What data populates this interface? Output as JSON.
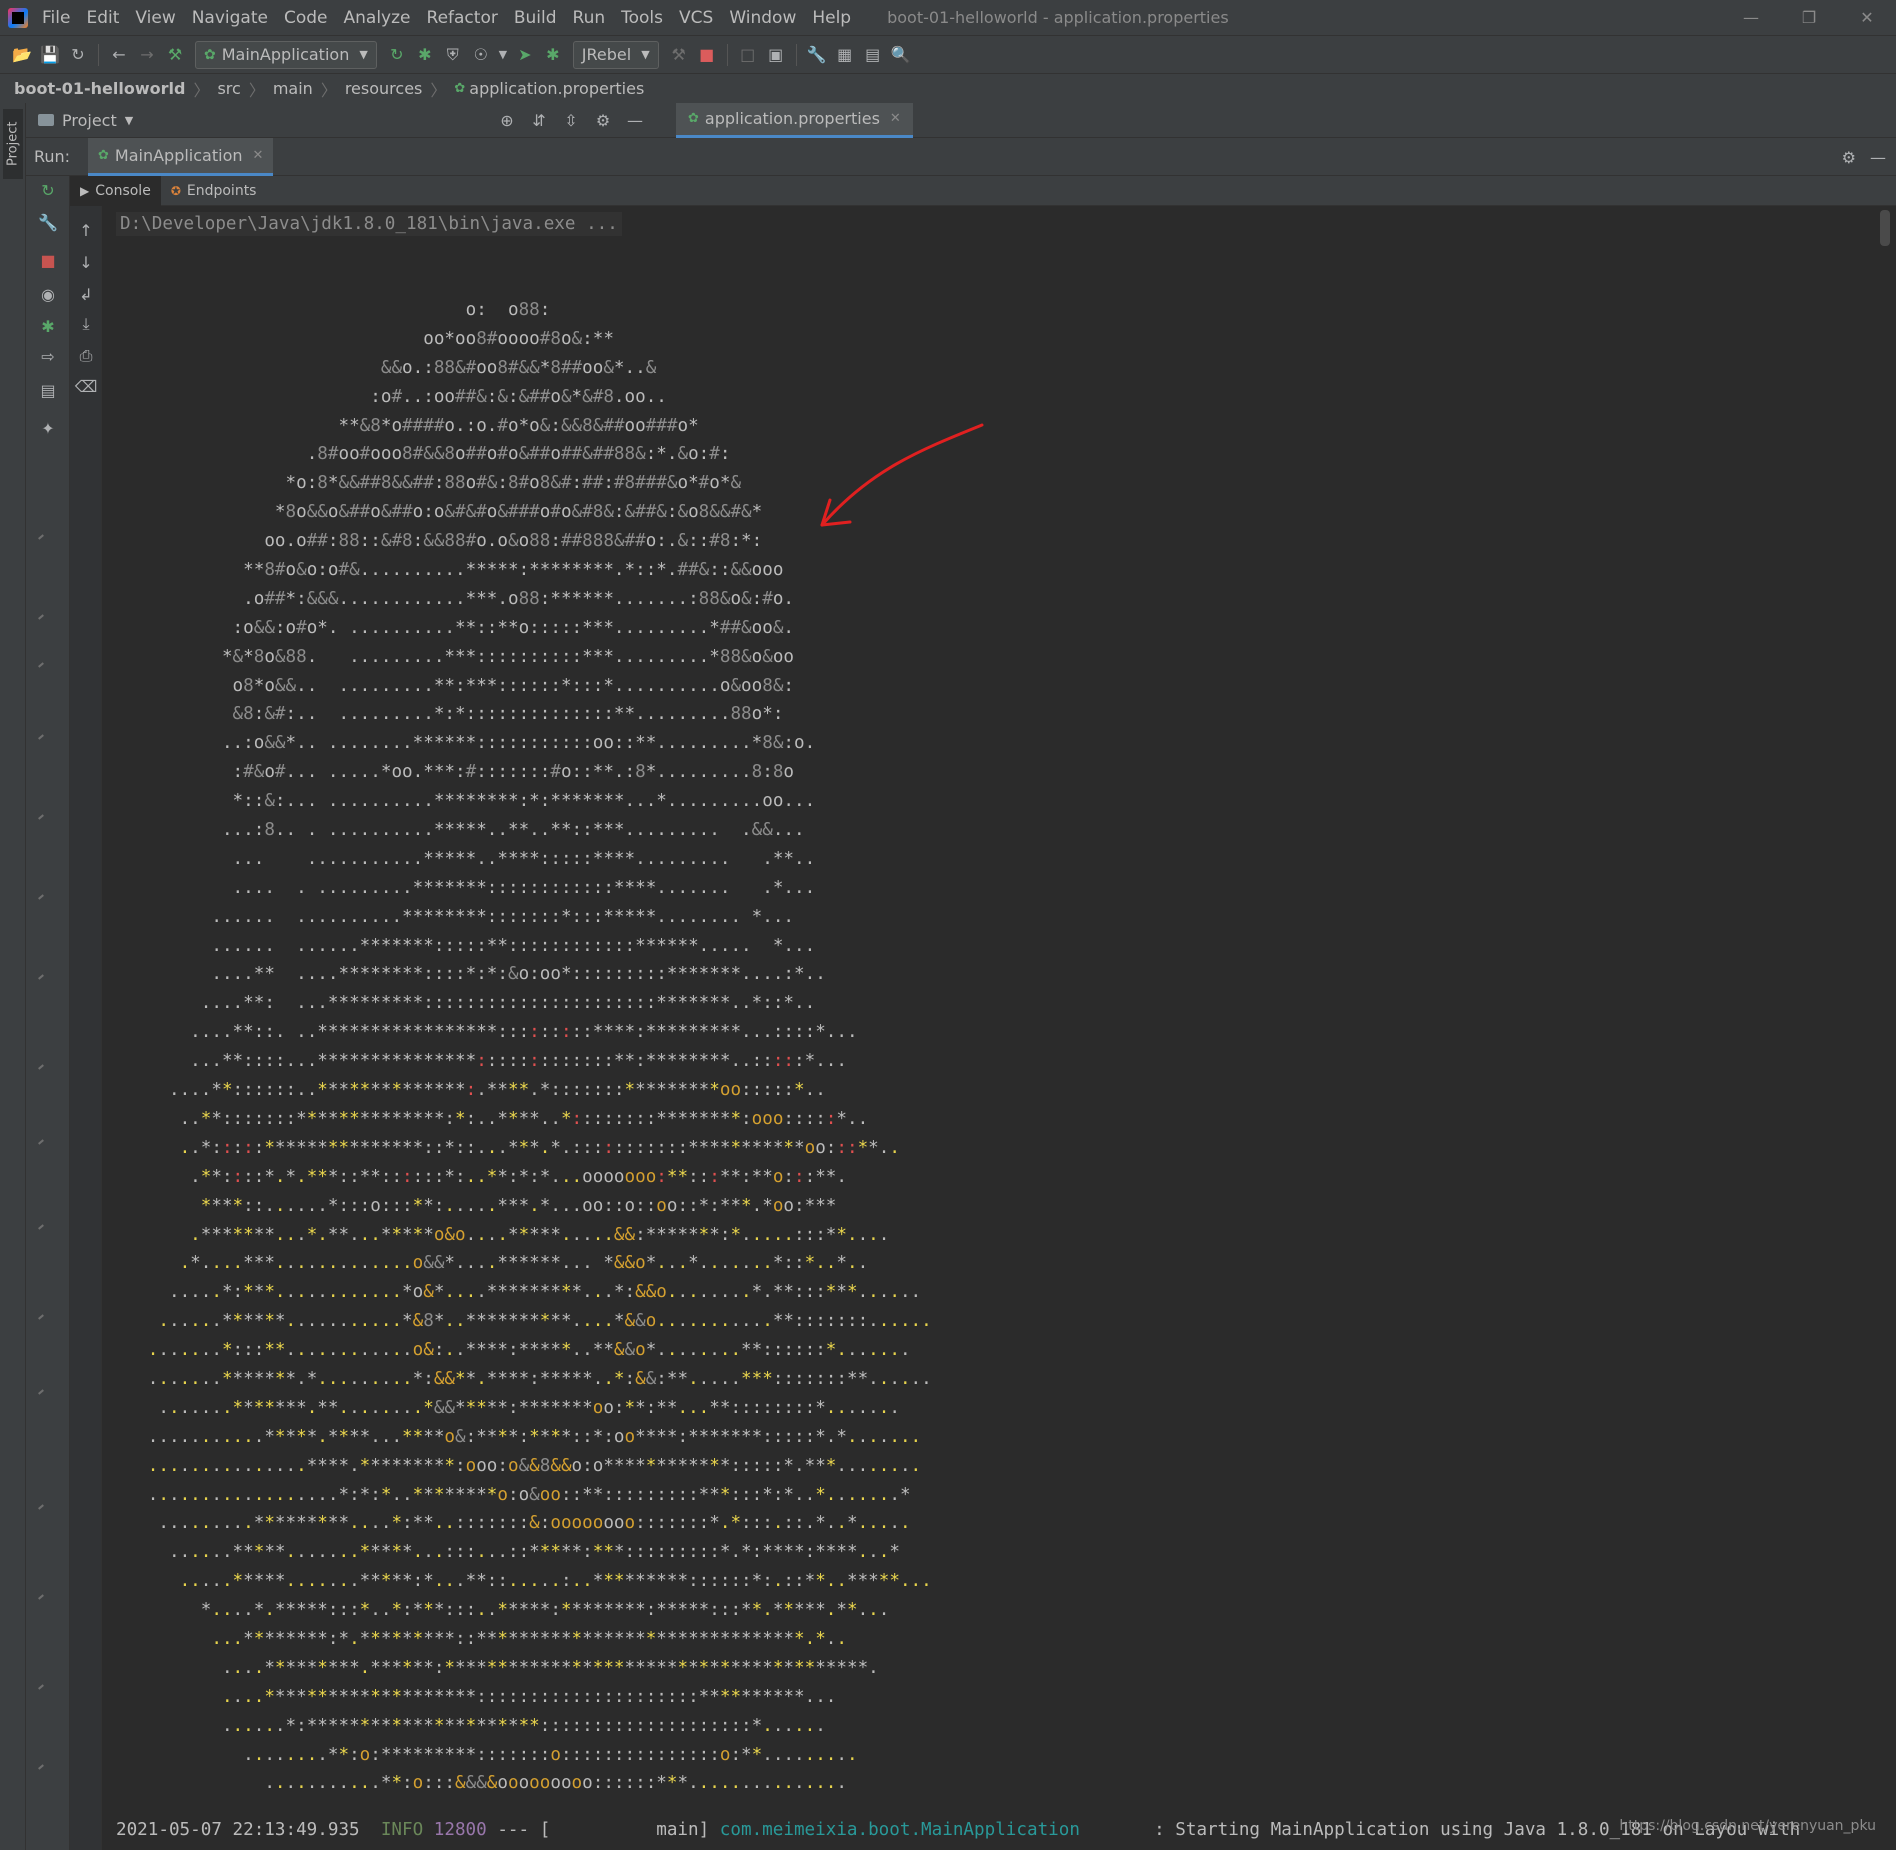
{
  "menu": {
    "items": [
      "File",
      "Edit",
      "View",
      "Navigate",
      "Code",
      "Analyze",
      "Refactor",
      "Build",
      "Run",
      "Tools",
      "VCS",
      "Window",
      "Help"
    ],
    "window_title": "boot-01-helloworld - application.properties"
  },
  "toolbar": {
    "run_config": "MainApplication",
    "jrebel": "JRebel"
  },
  "breadcrumb": {
    "items": [
      "boot-01-helloworld",
      "src",
      "main",
      "resources",
      "application.properties"
    ]
  },
  "project_panel": {
    "stripe_label": "Project",
    "title": "Project"
  },
  "editor": {
    "tab_label": "application.properties"
  },
  "run_panel": {
    "label": "Run:",
    "tab_label": "MainApplication",
    "subtabs": [
      "Console",
      "Endpoints"
    ]
  },
  "console": {
    "command": "D:\\Developer\\Java\\jdk1.8.0_181\\bin\\java.exe ...",
    "log_timestamp": "2021-05-07 22:13:49.935",
    "log_level": "INFO",
    "log_pid": "12800",
    "log_sep": "--- [",
    "log_thread": "          main]",
    "log_class": "com.meimeixia.boot.MainApplication",
    "log_msg": "       : Starting MainApplication using Java 1.8.0_181 on Layou with",
    "watermark": "https://blog.csdn.net/yerenyuan_pku"
  },
  "ascii_art": [
    "                                 o:  o88:",
    "                             oo*oo8#oooo#8o&:**",
    "                         &&o.:88&#oo8#&&*8##oo&*..&",
    "                        :o#..:oo##&:&:&##o&*&#8.oo..",
    "                     **&8*o####o.:o.#o*o&:&&8&##oo###o*",
    "                  .8#oo#ooo8#&&8o##o#o&##o##&##88&:*.&o:#:",
    "                *o:8*&&##8&&##:88o#&:8#o8&#:##:#8###&o*#o*&",
    "               *8o&&o&##o&##o:o&#&#o&###o#o&#8&:&##&:&o8&&#&*",
    "              oo.o##:88::&#8:&&88#o.o&o88:##888&##o:.&::#8:*:",
    "            **8#o&o:o#&..........*****:********.*::*.##&::&&ooo",
    "            .o##*:&&&............***.o88:******.......:88&o&:#o.",
    "           :o&&:o#o*. ..........**::**o:::::***.........*##&oo&.",
    "          *&*8o&88.   .........***::::::::::***.........*88&o&oo",
    "           o8*o&&..  .........**:***::::::*:::*..........o&oo8&:",
    "           &8:&#:..  .........*:*::::::::::::::**.........88o*:",
    "          ..:o&&*.. ........******:::::::::::oo::**.........*8&:o.",
    "           :#&o#... .....*oo.***:#:::::::#o::**.:8*.........8:8o",
    "           *::&:... ..........********:*:*******...*.........oo...",
    "          ...:8.. . ..........*****..**..**::***.........  .&&...",
    "           ...    ...........*****..****:::::****.........   .**..",
    "           ....  . .........*******::::::::::::****.......   .*...",
    "         ......  ..........********:::::::*:::*****........ *...",
    "         ......  ......*******:::::**::::::::::::******.....  *...",
    "         ....**  ....********::::*:*:&o:oo*:::::::::*******....:*..",
    "        ....**:  ...*********::::::::::::::::::::::*******..*::*..",
    "       ....**::. ..*****************:::::::::****:*********...::::*...",
    "       ...**::::...***************:::::::::::::**:********..:::::*...",
    "     ....**::::::..**************:.****.*:::::::*********oo:::::*..",
    "      ..**:::::::**************:*:..****..*::::::::********:ooo:::::*..",
    "      ..*:::::***************::*::...***.*.:::::::::::***********oo:::**..",
    "       .**::::*.*.***::**::::::*:..**:*:*...ooooooo:**:::**:**o:::**.",
    "        ****::......*:::o:::**:.....***.*...oo::o::oo::*:***.*oo:***",
    "       .*******...*.**...*****o&o....*****.....&&:*******:*.....:::**....",
    "      .*....***.............o&&*....******... *&&o*...*.......*::*..*..",
    "     .....*:***............*o&*....*********...*:&&o........*.**:::***......",
    "    ......******...........*&8*..**********....*&&o...........**:::::::......",
    "   .......*:::**............o&:..****:*****..**&&o*........**::::::*.......",
    "   .......*******.*.........*:&&**.****:*****..*:&&:**.....***:::::::**......",
    "    .......*******.**........*&&*****:*******oo:**:**...**::::::::*.......",
    "   ...........*****.****...****o&:****:****::*:oo****:*******:::::*.*.......",
    "   ...............****.*********:ooo:o&&8&&o:o************:::::*.***........",
    "   ..................*:*:*..********o:o&oo::**:::::::::***:::*:*..*.......*",
    "    .........*********....*:**..:::::::&:oooooooo:::::::*.*:::.::.*..*.....",
    "     ......*****.......*****...:::...::*****:***:::::::::*.*:****:****...*",
    "      .....*****.......*****:*...**::.....:..*********::::::*:.::**..*****...",
    "        *....*.*****:::*..*:***:::..*****:********:*****:::**.*****.**...",
    "         ...********:*.*********::*******************************.*..",
    "          ....*********.******:****************************************.",
    "          ....********************:::::::::::::::::::::**********...",
    "          ......*:**********************::::::::::::::::::::*......",
    "            ........**:o:*********:::::::o:::::::::::::::o:**.........",
    "              ...........**:o:::&&&&ooooooooo::::::***..............."
  ],
  "colors": {
    "bg": "#2b2b2b",
    "panel": "#3c3f41",
    "accent": "#4a88c7",
    "run_green": "#59a869",
    "stop_red": "#c75450",
    "annotation_arrow": "#e02020",
    "log_info": "#6a8759",
    "log_class": "#299999"
  },
  "icons": {
    "toolbar": [
      "open-folder-icon",
      "save-icon",
      "sync-icon",
      "back-arrow-icon",
      "forward-arrow-icon",
      "build-hammer-icon",
      "rerun-icon",
      "debug-bug-icon",
      "coverage-icon",
      "profile-icon",
      "jrebel-run-icon",
      "jrebel-debug-icon",
      "stop-icon",
      "attach-icon",
      "sdk-icon",
      "settings-wrench-icon",
      "project-structure-icon",
      "terminal-icon",
      "search-icon"
    ]
  }
}
